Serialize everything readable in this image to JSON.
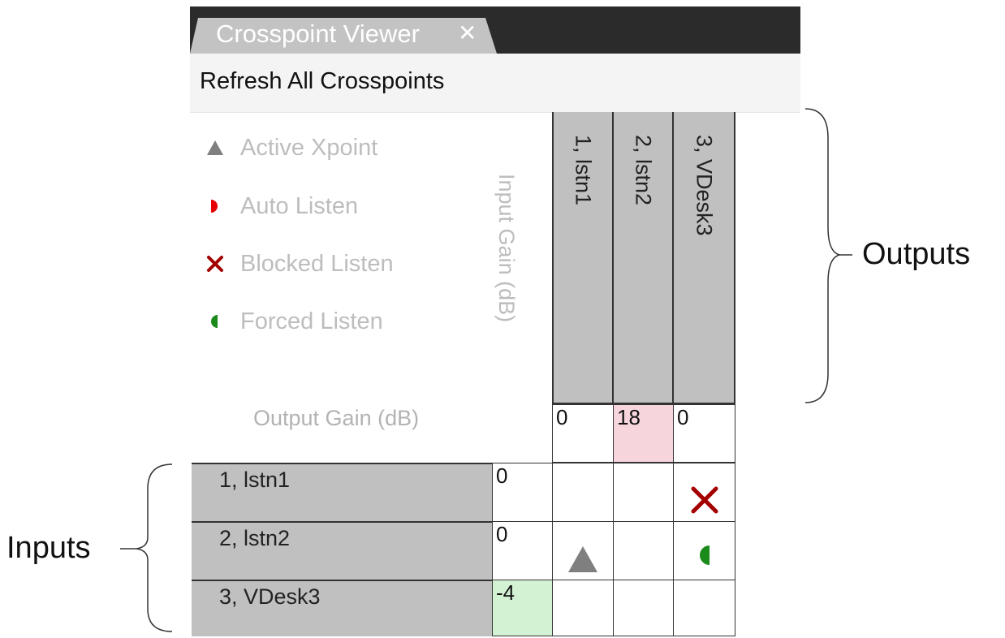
{
  "window": {
    "tab_title": "Crosspoint Viewer",
    "close_glyph": "✕",
    "toolbar_action": "Refresh All Crosspoints"
  },
  "legend": [
    {
      "label": "Active Xpoint",
      "icon": "active-triangle-icon",
      "color": "#7f7f7f"
    },
    {
      "label": "Auto Listen",
      "icon": "auto-listen-half-circle-icon",
      "color": "#e60000"
    },
    {
      "label": "Blocked Listen",
      "icon": "blocked-x-icon",
      "color": "#a30000"
    },
    {
      "label": "Forced Listen",
      "icon": "forced-listen-half-circle-icon",
      "color": "#1a8a1a"
    }
  ],
  "labels": {
    "input_gain": "Input Gain (dB)",
    "output_gain": "Output Gain (dB)"
  },
  "outputs": [
    {
      "name": "1, lstn1",
      "gain": "0",
      "gain_highlight": ""
    },
    {
      "name": "2, lstn2",
      "gain": "18",
      "gain_highlight": "#f6d5dc"
    },
    {
      "name": "3, VDesk3",
      "gain": "0",
      "gain_highlight": ""
    }
  ],
  "inputs": [
    {
      "name": "1, lstn1",
      "gain": "0",
      "gain_highlight": "",
      "crosspoints": [
        "",
        "",
        "blocked"
      ]
    },
    {
      "name": "2, lstn2",
      "gain": "0",
      "gain_highlight": "",
      "crosspoints": [
        "active",
        "",
        "forced"
      ]
    },
    {
      "name": "3, VDesk3",
      "gain": "-4",
      "gain_highlight": "#d3f2d3",
      "crosspoints": [
        "",
        "",
        ""
      ]
    }
  ],
  "annotations": {
    "outputs": "Outputs",
    "inputs": "Inputs"
  }
}
